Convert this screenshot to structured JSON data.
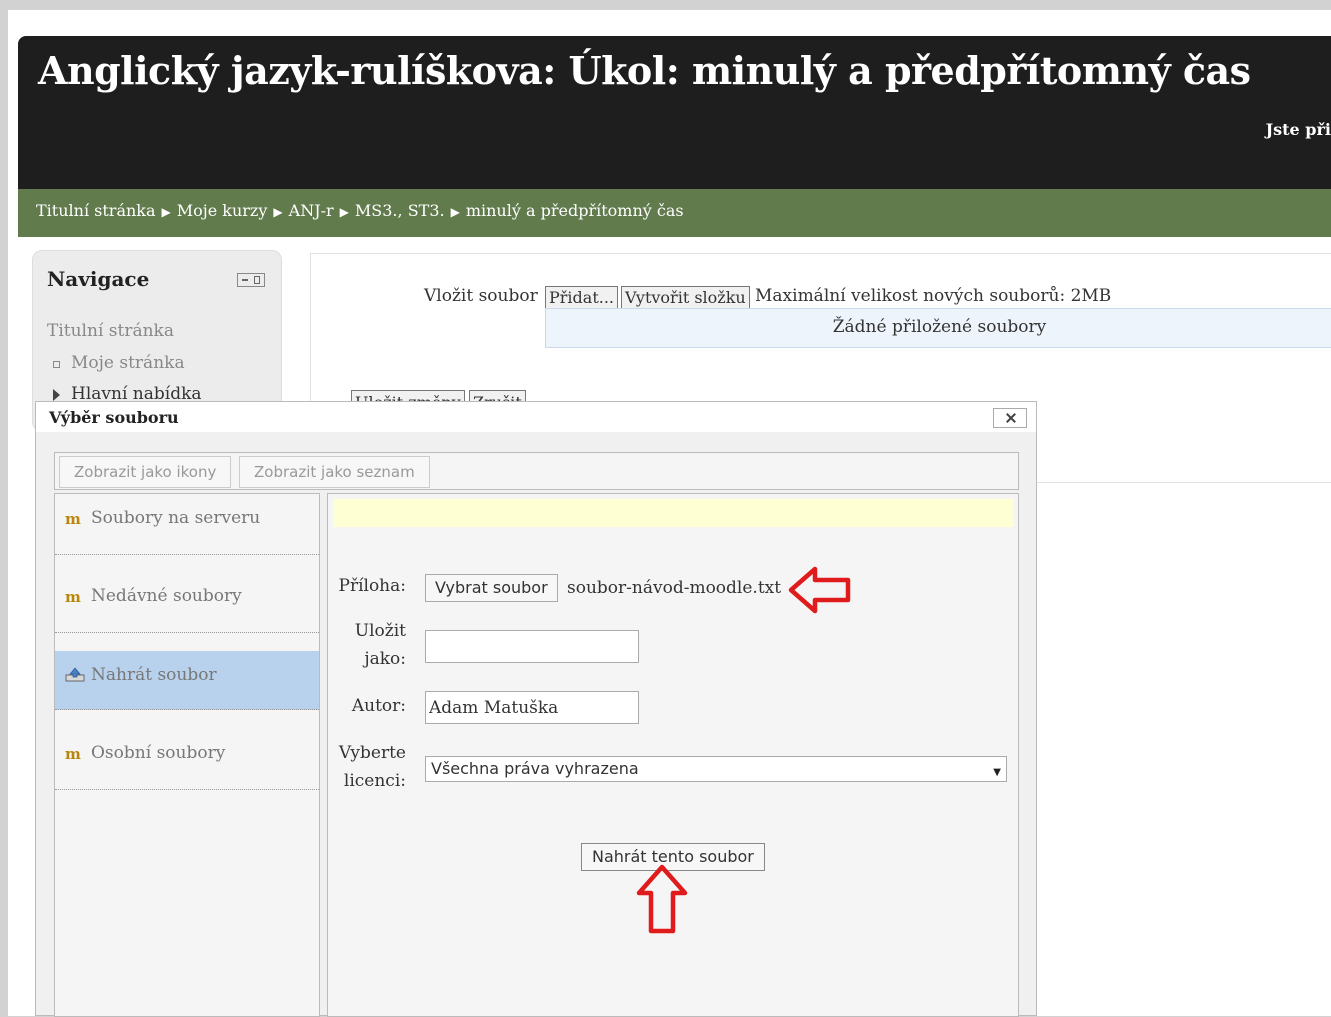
{
  "header": {
    "title": "Anglický jazyk-rulíškova: Úkol: minulý a předpřítomný čas",
    "login_partial": "Jste při"
  },
  "breadcrumb": [
    "Titulní stránka",
    "Moje kurzy",
    "ANJ-r",
    "MS3., ST3.",
    "minulý a předpřítomný čas"
  ],
  "navigation": {
    "title": "Navigace",
    "home": "Titulní stránka",
    "my_page": "Moje stránka",
    "main_menu": "Hlavní nabídka"
  },
  "filemanager": {
    "label": "Vložit soubor",
    "add_button": "Přidat...",
    "create_folder_button": "Vytvořit složku",
    "max_size": "Maximální velikost nových souborů: 2MB",
    "no_files": "Žádné přiložené soubory",
    "save_button": "Uložit změny",
    "cancel_button": "Zrušit"
  },
  "dialog": {
    "title": "Výběr souboru",
    "tabs": [
      "Zobrazit jako ikony",
      "Zobrazit jako seznam"
    ],
    "repositories": [
      {
        "label": "Soubory na serveru",
        "icon": "moodle-logo-icon"
      },
      {
        "label": "Nedávné soubory",
        "icon": "moodle-logo-icon"
      },
      {
        "label": "Nahrát soubor",
        "icon": "upload-icon",
        "active": true
      },
      {
        "label": "Osobní soubory",
        "icon": "moodle-logo-icon"
      }
    ],
    "form": {
      "attachment_label": "Příloha:",
      "choose_button": "Vybrat soubor",
      "chosen_file": "soubor-návod-moodle.txt",
      "save_as_label_1": "Uložit",
      "save_as_label_2": "jako:",
      "save_as_value": "",
      "author_label": "Autor:",
      "author_value": "Adam Matuška",
      "license_label_1": "Vyberte",
      "license_label_2": "licenci:",
      "license_value": "Všechna práva vyhrazena",
      "upload_button": "Nahrát tento soubor"
    }
  },
  "colors": {
    "header_bg": "#1e1e1e",
    "navbar_bg": "#617b4d",
    "active_repo": "#b8d2ee",
    "annotation_red": "#e01b1b"
  }
}
